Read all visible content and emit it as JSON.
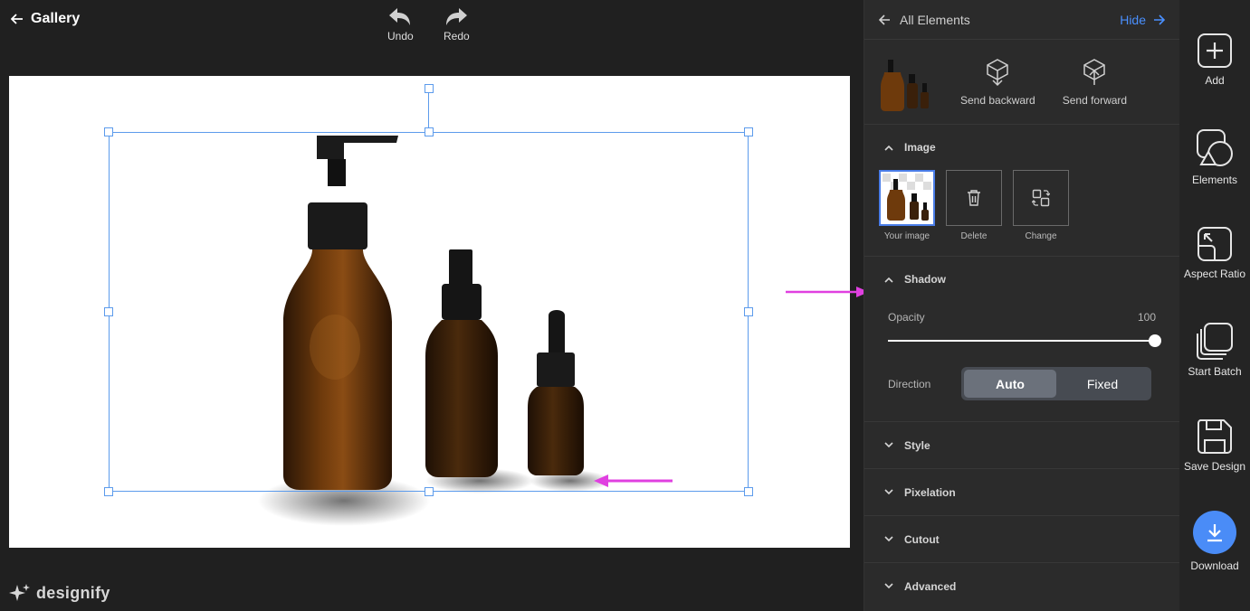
{
  "topbar": {
    "back_label": "Gallery",
    "undo_label": "Undo",
    "redo_label": "Redo"
  },
  "brand": {
    "name": "designify"
  },
  "panel": {
    "header": {
      "all_elements_label": "All Elements",
      "hide_label": "Hide"
    },
    "layer_actions": {
      "send_backward_label": "Send backward",
      "send_forward_label": "Send forward"
    },
    "image_section": {
      "title": "Image",
      "tiles": [
        {
          "label": "Your image"
        },
        {
          "label": "Delete"
        },
        {
          "label": "Change"
        }
      ]
    },
    "shadow_section": {
      "title": "Shadow",
      "opacity_label": "Opacity",
      "opacity_value": "100",
      "direction_label": "Direction",
      "direction_options": [
        "Auto",
        "Fixed"
      ],
      "direction_selected": "Auto"
    },
    "collapsed_sections": [
      "Style",
      "Pixelation",
      "Cutout",
      "Advanced"
    ]
  },
  "rail": {
    "items": [
      {
        "label": "Add"
      },
      {
        "label": "Elements"
      },
      {
        "label": "Aspect Ratio"
      },
      {
        "label": "Start Batch"
      },
      {
        "label": "Save Design"
      },
      {
        "label": "Download"
      }
    ]
  },
  "colors": {
    "accent": "#4a90ff",
    "selection": "#5c9bec",
    "annotation_arrow": "#e040e0",
    "download_button": "#4a8cf7"
  }
}
